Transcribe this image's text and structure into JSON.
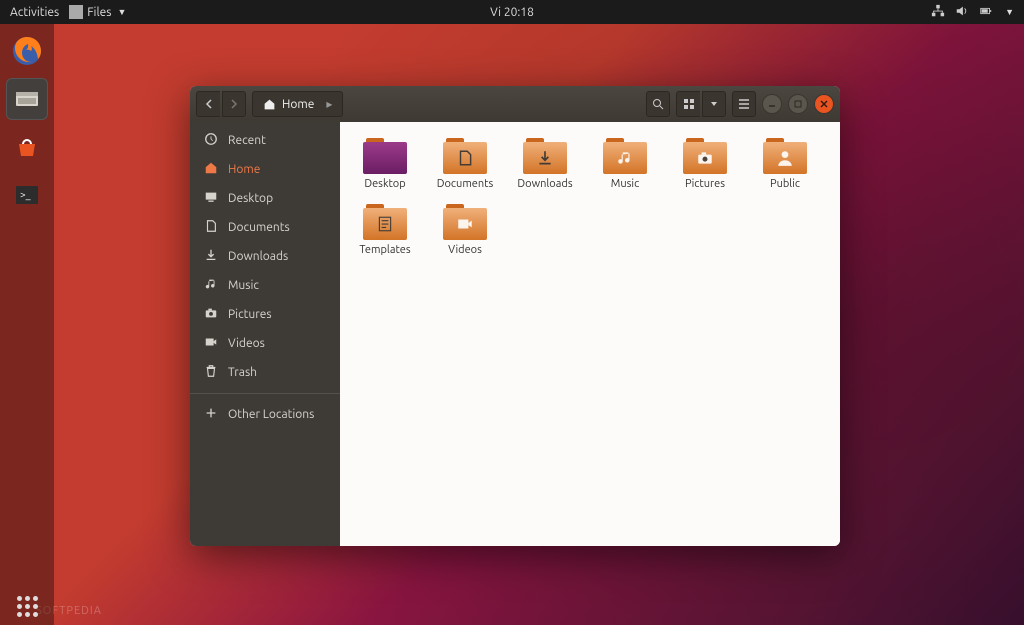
{
  "topbar": {
    "activities": "Activities",
    "app_label": "Files",
    "clock": "Vi 20:18"
  },
  "watermark": "SOFTPEDIA",
  "window": {
    "path_label": "Home",
    "sidebar": [
      {
        "icon": "clock",
        "label": "Recent"
      },
      {
        "icon": "home",
        "label": "Home",
        "active": true
      },
      {
        "icon": "desktop",
        "label": "Desktop"
      },
      {
        "icon": "doc",
        "label": "Documents"
      },
      {
        "icon": "download",
        "label": "Downloads"
      },
      {
        "icon": "music",
        "label": "Music"
      },
      {
        "icon": "camera",
        "label": "Pictures"
      },
      {
        "icon": "video",
        "label": "Videos"
      },
      {
        "icon": "trash",
        "label": "Trash"
      }
    ],
    "sidebar_other": {
      "icon": "plus",
      "label": "Other Locations"
    },
    "folders": [
      {
        "name": "Desktop",
        "inner": "desk"
      },
      {
        "name": "Documents",
        "inner": "doc"
      },
      {
        "name": "Downloads",
        "inner": "download"
      },
      {
        "name": "Music",
        "inner": "music"
      },
      {
        "name": "Pictures",
        "inner": "camera"
      },
      {
        "name": "Public",
        "inner": "person"
      },
      {
        "name": "Templates",
        "inner": "template"
      },
      {
        "name": "Videos",
        "inner": "video"
      }
    ]
  }
}
